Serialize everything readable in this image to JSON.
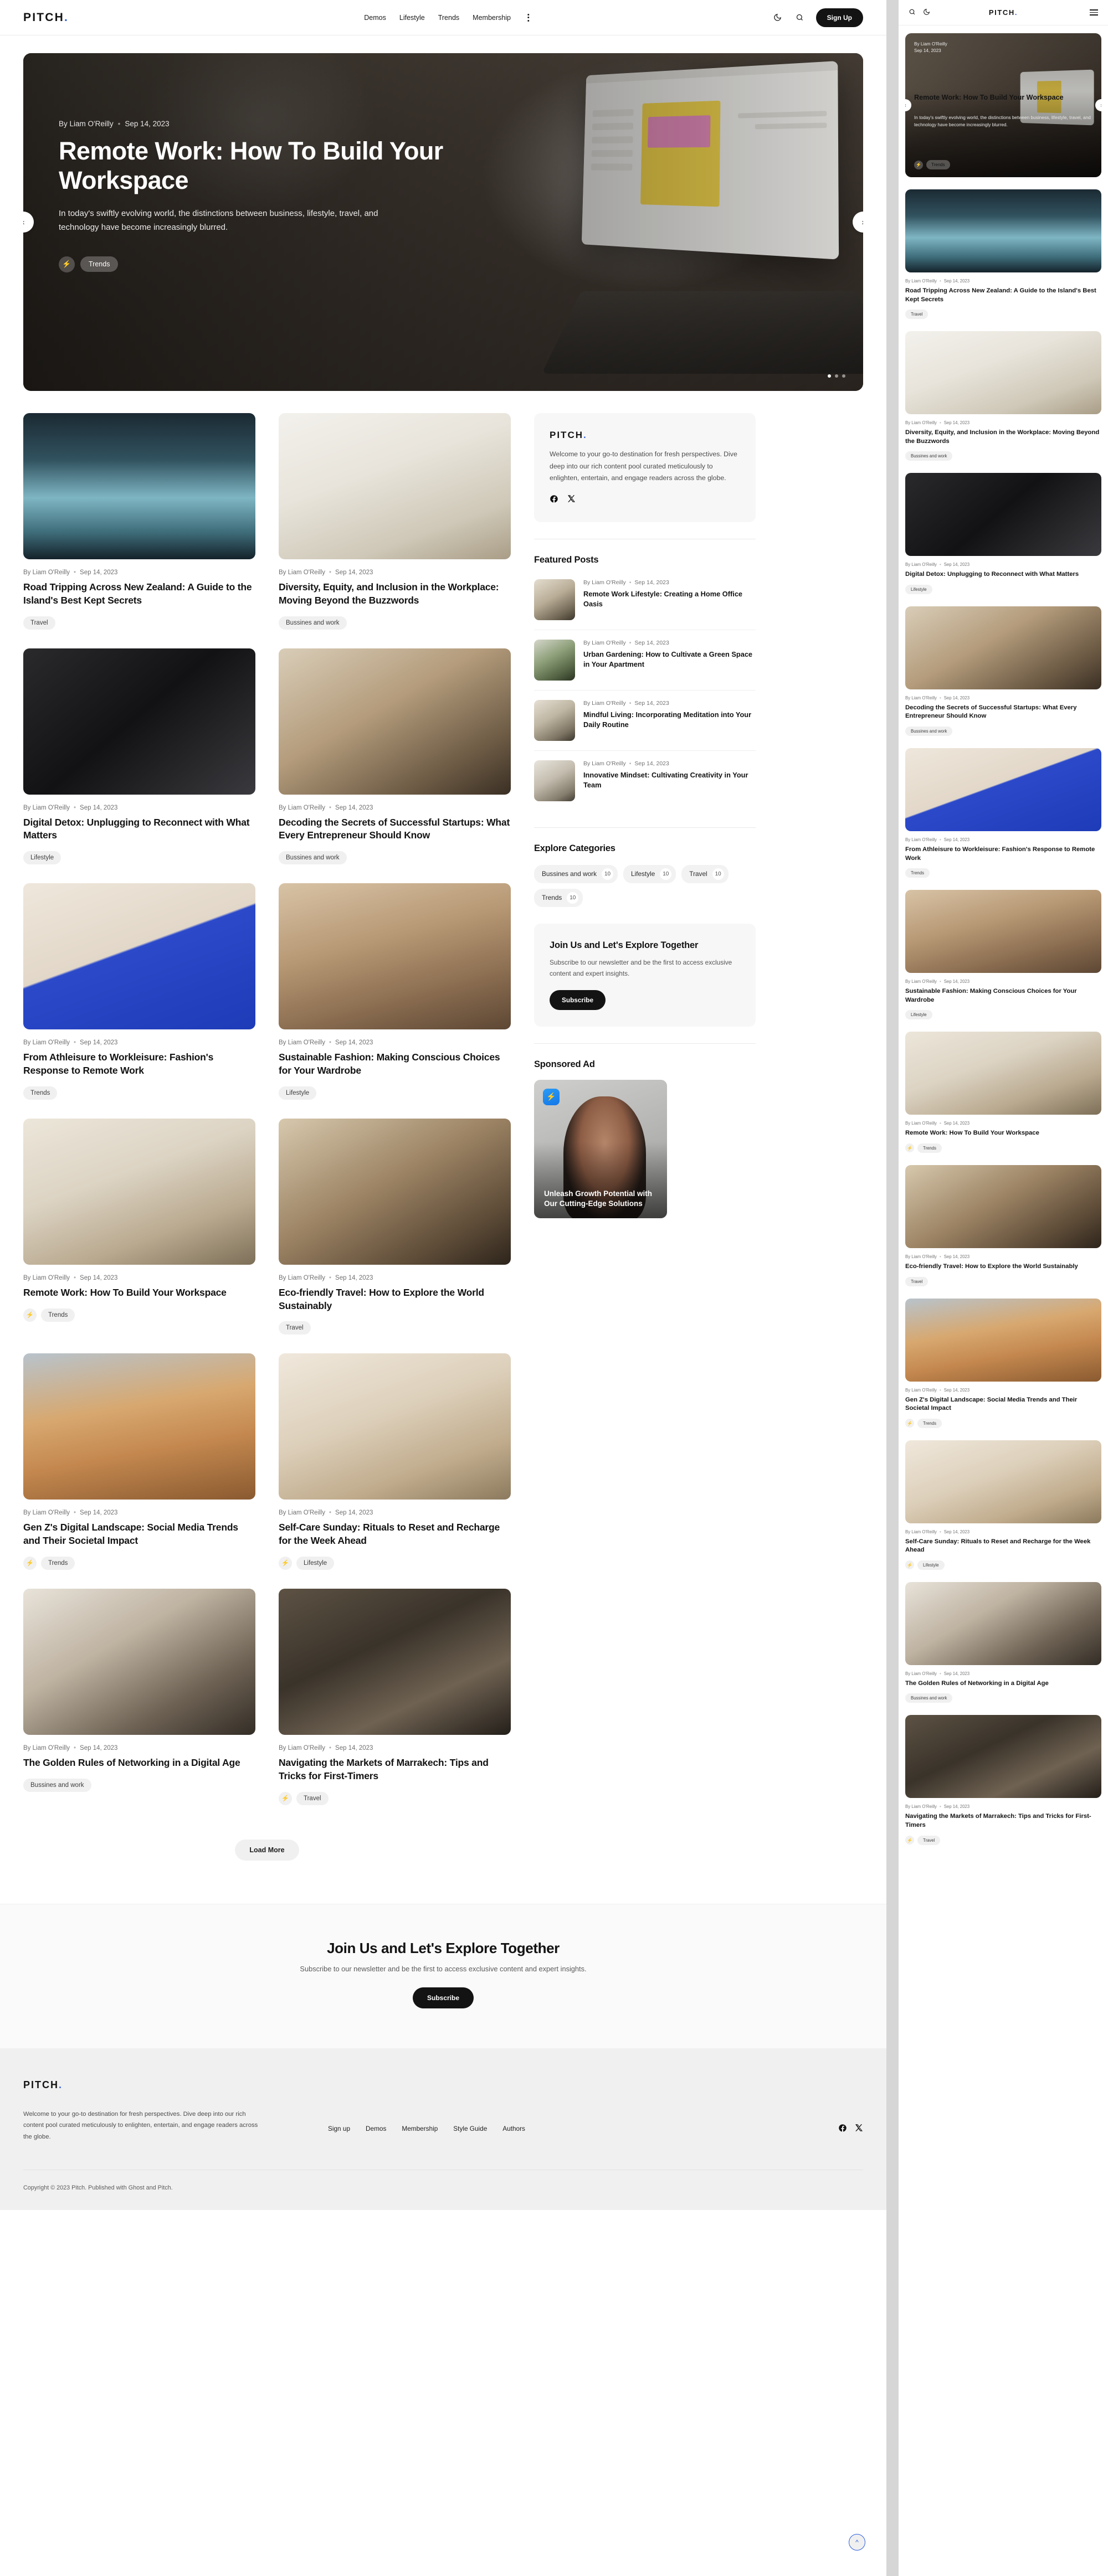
{
  "brand": {
    "name": "PITCH",
    "dot": ".",
    "accent": "#2f5fe0"
  },
  "header": {
    "nav": [
      "Demos",
      "Lifestyle",
      "Trends",
      "Membership"
    ],
    "kebab_label": "More",
    "moon_icon": "moon-icon",
    "search_icon": "search-icon",
    "signup_label": "Sign Up"
  },
  "hero": {
    "author": "By Liam O'Reilly",
    "date": "Sep 14, 2023",
    "title": "Remote Work: How To Build Your Workspace",
    "excerpt": "In today's swiftly evolving world, the distinctions between business, lifestyle, travel, and technology have become increasingly blurred.",
    "tag": "Trends",
    "prev_icon": "chevron-left-icon",
    "next_icon": "chevron-right-icon",
    "slide_count": 3,
    "active_slide": 1
  },
  "feed": {
    "author": "By Liam O'Reilly",
    "date": "Sep 14, 2023",
    "load_more_label": "Load More",
    "posts": [
      {
        "title": "Road Tripping Across New Zealand: A Guide to the Island's Best Kept Secrets",
        "tag": "Travel",
        "bolt": false,
        "img": "ph-lake"
      },
      {
        "title": "Diversity, Equity, and Inclusion in the Workplace: Moving Beyond the Buzzwords",
        "tag": "Bussines and work",
        "bolt": false,
        "img": "ph-desk"
      },
      {
        "title": "Digital Detox: Unplugging to Reconnect with What Matters",
        "tag": "Lifestyle",
        "bolt": false,
        "img": "ph-dark"
      },
      {
        "title": "Decoding the Secrets of Successful Startups: What Every Entrepreneur Should Know",
        "tag": "Bussines and work",
        "bolt": false,
        "img": "ph-sofa"
      },
      {
        "title": "From Athleisure to Workleisure: Fashion's Response to Remote Work",
        "tag": "Trends",
        "bolt": false,
        "img": "ph-phone"
      },
      {
        "title": "Sustainable Fashion: Making Conscious Choices for Your Wardrobe",
        "tag": "Lifestyle",
        "bolt": false,
        "img": "ph-rock"
      },
      {
        "title": "Remote Work: How To Build Your Workspace",
        "tag": "Trends",
        "bolt": true,
        "img": "ph-tablet"
      },
      {
        "title": "Eco-friendly Travel: How to Explore the World Sustainably",
        "tag": "Travel",
        "bolt": false,
        "img": "ph-cafe"
      },
      {
        "title": "Gen Z's Digital Landscape: Social Media Trends and Their Societal Impact",
        "tag": "Trends",
        "bolt": true,
        "img": "ph-dune"
      },
      {
        "title": "Self-Care Sunday: Rituals to Reset and Recharge for the Week Ahead",
        "tag": "Lifestyle",
        "bolt": true,
        "img": "ph-mac"
      },
      {
        "title": "The Golden Rules of Networking in a Digital Age",
        "tag": "Bussines and work",
        "bolt": false,
        "img": "ph-team"
      },
      {
        "title": "Navigating the Markets of Marrakech: Tips and Tricks for First-Timers",
        "tag": "Travel",
        "bolt": true,
        "img": "ph-tent"
      }
    ]
  },
  "sidebar": {
    "about": {
      "logo": "PITCH",
      "text": "Welcome to your go-to destination for fresh perspectives. Dive deep into our rich content pool curated meticulously to enlighten, entertain, and engage readers across the globe.",
      "facebook_icon": "facebook-icon",
      "x_icon": "x-twitter-icon"
    },
    "featured": {
      "title": "Featured Posts",
      "author": "By Liam O'Reilly",
      "date": "Sep 14, 2023",
      "items": [
        {
          "title": "Remote Work Lifestyle: Creating a Home Office Oasis",
          "img": "ph-office"
        },
        {
          "title": "Urban Gardening: How to Cultivate a Green Space in Your Apartment",
          "img": "ph-garden"
        },
        {
          "title": "Mindful Living: Incorporating Meditation into Your Daily Routine",
          "img": "ph-mind"
        },
        {
          "title": "Innovative Mindset: Cultivating Creativity in Your Team",
          "img": "ph-innov"
        }
      ]
    },
    "categories": {
      "title": "Explore Categories",
      "items": [
        {
          "label": "Bussines and work",
          "count": "10"
        },
        {
          "label": "Lifestyle",
          "count": "10"
        },
        {
          "label": "Travel",
          "count": "10"
        },
        {
          "label": "Trends",
          "count": "10"
        }
      ]
    },
    "newsletter": {
      "title": "Join Us and Let's Explore Together",
      "text": "Subscribe to our newsletter and be the first to access exclusive content and expert insights.",
      "button": "Subscribe"
    },
    "sponsored": {
      "title": "Sponsored Ad",
      "badge_icon": "bolt-icon",
      "headline": "Unleash Growth Potential with Our Cutting-Edge Solutions"
    }
  },
  "band": {
    "title": "Join Us and Let's Explore Together",
    "text": "Subscribe to our newsletter and be the first to access exclusive content and expert insights.",
    "button": "Subscribe"
  },
  "footer": {
    "logo": "PITCH",
    "about": "Welcome to your go-to destination for fresh perspectives. Dive deep into our rich content pool curated meticulously to enlighten, entertain, and engage readers across the globe.",
    "links": [
      "Sign up",
      "Demos",
      "Membership",
      "Style Guide",
      "Authors"
    ],
    "facebook_icon": "facebook-icon",
    "x_icon": "x-twitter-icon",
    "copyright": "Copyright © 2023 Pitch. Published with Ghost and Pitch.",
    "to_top_icon": "chevron-up-icon"
  },
  "mobile": {
    "search_icon": "search-icon",
    "moon_icon": "moon-icon",
    "logo": "PITCH",
    "menu_icon": "hamburger-menu-icon",
    "hero": {
      "author": "By Liam O'Reilly",
      "date": "Sep 14, 2023",
      "title": "Remote Work: How To Build Your Workspace",
      "excerpt": "In today's swiftly evolving world, the distinctions between business, lifestyle, travel, and technology have become increasingly blurred.",
      "tag": "Trends"
    },
    "author": "By Liam O'Reilly",
    "date": "Sep 14, 2023",
    "posts": [
      {
        "title": "Road Tripping Across New Zealand: A Guide to the Island's Best Kept Secrets",
        "tag": "Travel",
        "bolt": false,
        "img": "ph-lake"
      },
      {
        "title": "Diversity, Equity, and Inclusion in the Workplace: Moving Beyond the Buzzwords",
        "tag": "Bussines and work",
        "bolt": false,
        "img": "ph-desk"
      },
      {
        "title": "Digital Detox: Unplugging to Reconnect with What Matters",
        "tag": "Lifestyle",
        "bolt": false,
        "img": "ph-dark"
      },
      {
        "title": "Decoding the Secrets of Successful Startups: What Every Entrepreneur Should Know",
        "tag": "Bussines and work",
        "bolt": false,
        "img": "ph-sofa"
      },
      {
        "title": "From Athleisure to Workleisure: Fashion's Response to Remote Work",
        "tag": "Trends",
        "bolt": false,
        "img": "ph-phone"
      },
      {
        "title": "Sustainable Fashion: Making Conscious Choices for Your Wardrobe",
        "tag": "Lifestyle",
        "bolt": false,
        "img": "ph-rock"
      },
      {
        "title": "Remote Work: How To Build Your Workspace",
        "tag": "Trends",
        "bolt": true,
        "img": "ph-tablet"
      },
      {
        "title": "Eco-friendly Travel: How to Explore the World Sustainably",
        "tag": "Travel",
        "bolt": false,
        "img": "ph-cafe"
      },
      {
        "title": "Gen Z's Digital Landscape: Social Media Trends and Their Societal Impact",
        "tag": "Trends",
        "bolt": true,
        "img": "ph-dune"
      },
      {
        "title": "Self-Care Sunday: Rituals to Reset and Recharge for the Week Ahead",
        "tag": "Lifestyle",
        "bolt": true,
        "img": "ph-mac"
      },
      {
        "title": "The Golden Rules of Networking in a Digital Age",
        "tag": "Bussines and work",
        "bolt": false,
        "img": "ph-team"
      },
      {
        "title": "Navigating the Markets of Marrakech: Tips and Tricks for First-Timers",
        "tag": "Travel",
        "bolt": true,
        "img": "ph-tent"
      }
    ]
  }
}
